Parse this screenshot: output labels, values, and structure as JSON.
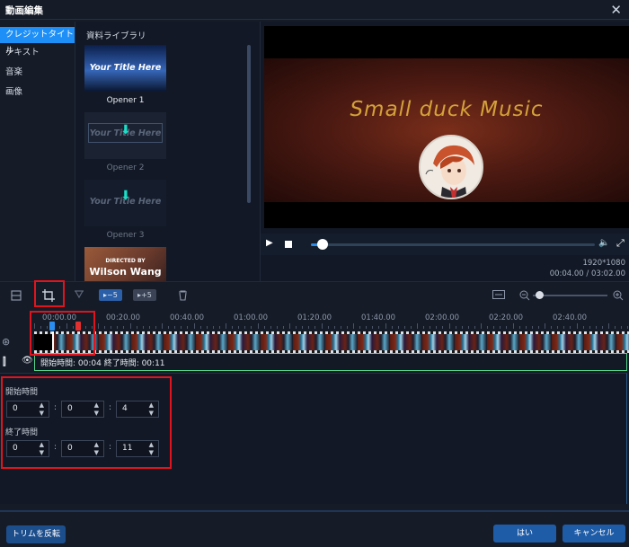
{
  "window": {
    "title": "動画編集"
  },
  "sidebar": {
    "items": [
      {
        "label": "クレジットタイトル"
      },
      {
        "label": "テキスト"
      },
      {
        "label": "音楽"
      },
      {
        "label": "画像"
      }
    ]
  },
  "library": {
    "title": "資料ライブラリ",
    "items": [
      {
        "thumb_text": "Your Title Here",
        "caption": "Opener 1"
      },
      {
        "thumb_text": "Your Title Here",
        "caption": "Opener 2"
      },
      {
        "thumb_text": "Your Title Here",
        "caption": "Opener 3"
      },
      {
        "thumb_text_small": "DIRECTED BY",
        "thumb_text": "Wilson Wang"
      }
    ]
  },
  "preview": {
    "video_title": "Small duck Music",
    "progress_fraction": 0.04,
    "resolution": "1920*1080",
    "time": "00:04.00 / 03:02.00"
  },
  "toolbar": {
    "badge_minus": "▸−5",
    "badge_plus": "▸+5"
  },
  "timeline": {
    "ticks": [
      "00:00.00",
      "00:20.00",
      "00:40.00",
      "01:00.00",
      "01:20.00",
      "01:40.00",
      "02:00.00",
      "02:20.00",
      "02:40.00"
    ],
    "range_text": "開始時間: 00:04   終了時間: 00:11"
  },
  "trim": {
    "start_label": "開始時間",
    "end_label": "終了時間",
    "start": [
      "0",
      "0",
      "4"
    ],
    "end": [
      "0",
      "0",
      "11"
    ]
  },
  "buttons": {
    "reverse_trim": "トリムを反転",
    "ok": "はい",
    "cancel": "キャンセル"
  },
  "colors": {
    "accent": "#1e8ff7",
    "highlight": "#e0141e",
    "range_border": "#54d28a"
  }
}
